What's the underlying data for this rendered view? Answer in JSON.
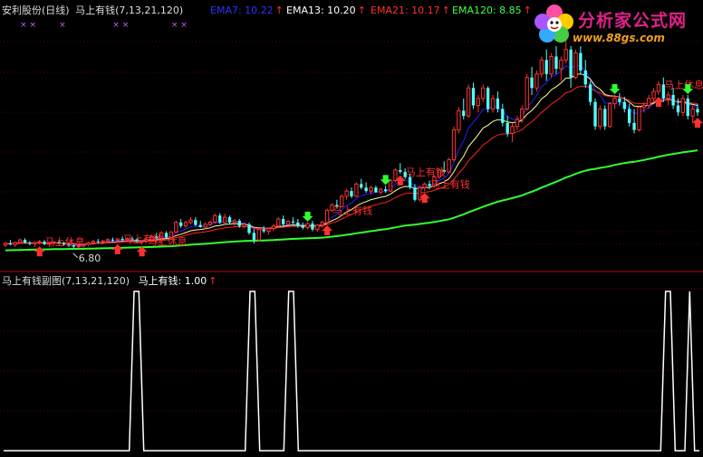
{
  "header": {
    "title": "安利股份(日线)",
    "indicator": "马上有钱(7,13,21,120)",
    "ema7": "EMA7: 10.22",
    "ema13": "EMA13: 10.20",
    "ema21": "EMA21: 10.17",
    "ema120": "EMA120: 8.85",
    "up_arrow": "↑"
  },
  "sub_header": {
    "title": "马上有钱副图(7,13,21,120)",
    "value": "马上有钱: 1.00",
    "up_arrow": "↑"
  },
  "logo": {
    "title": "分析家公式网",
    "url": "www.88gs.com"
  },
  "colors": {
    "background": "#000000",
    "bull_candle": "#ff3232",
    "bear_candle": "#54ffff",
    "ema7": "#2020ff",
    "ema13": "#ffff99",
    "ema21": "#ff2020",
    "ema120": "#30ff30",
    "signal_line": "#ffffff",
    "panel_border": "#c00000"
  },
  "chart_data": [
    {
      "type": "candlestick",
      "ylim": [
        6.2,
        13.4
      ],
      "price_labels": [
        {
          "text": "6.80",
          "index": 15,
          "value": 6.8
        }
      ],
      "candles": [
        [
          6.9,
          7.0,
          6.85,
          6.95
        ],
        [
          6.95,
          7.05,
          6.9,
          6.92
        ],
        [
          6.92,
          7.0,
          6.85,
          6.98
        ],
        [
          6.98,
          7.1,
          6.95,
          7.05
        ],
        [
          7.05,
          7.1,
          6.95,
          6.97
        ],
        [
          6.97,
          7.02,
          6.9,
          6.94
        ],
        [
          6.94,
          7.0,
          6.85,
          6.98
        ],
        [
          6.98,
          7.05,
          6.92,
          7.0
        ],
        [
          7.0,
          7.05,
          6.9,
          6.93
        ],
        [
          6.93,
          6.98,
          6.85,
          6.96
        ],
        [
          6.96,
          7.02,
          6.92,
          6.99
        ],
        [
          6.99,
          7.05,
          6.93,
          6.95
        ],
        [
          6.95,
          7.0,
          6.88,
          6.92
        ],
        [
          6.92,
          6.98,
          6.85,
          6.9
        ],
        [
          6.9,
          6.95,
          6.82,
          6.86
        ],
        [
          6.86,
          6.92,
          6.8,
          6.88
        ],
        [
          6.88,
          6.95,
          6.84,
          6.92
        ],
        [
          6.92,
          7.0,
          6.88,
          6.97
        ],
        [
          6.97,
          7.05,
          6.92,
          7.01
        ],
        [
          7.01,
          7.08,
          6.95,
          6.99
        ],
        [
          6.99,
          7.05,
          6.93,
          7.02
        ],
        [
          7.02,
          7.1,
          6.98,
          7.06
        ],
        [
          7.06,
          7.12,
          7.0,
          7.04
        ],
        [
          7.04,
          7.1,
          6.98,
          7.08
        ],
        [
          7.08,
          7.15,
          7.02,
          7.05
        ],
        [
          7.05,
          7.12,
          7.0,
          7.09
        ],
        [
          7.09,
          7.15,
          7.03,
          7.07
        ],
        [
          7.07,
          7.1,
          6.98,
          7.0
        ],
        [
          7.0,
          7.05,
          6.92,
          7.02
        ],
        [
          7.02,
          7.1,
          6.98,
          7.06
        ],
        [
          7.06,
          7.2,
          7.02,
          7.15
        ],
        [
          7.15,
          7.25,
          7.05,
          7.1
        ],
        [
          7.1,
          7.3,
          7.08,
          7.25
        ],
        [
          7.25,
          7.3,
          7.1,
          7.12
        ],
        [
          7.12,
          7.3,
          7.1,
          7.28
        ],
        [
          7.28,
          7.6,
          7.25,
          7.55
        ],
        [
          7.55,
          7.65,
          7.4,
          7.45
        ],
        [
          7.45,
          7.6,
          7.4,
          7.55
        ],
        [
          7.55,
          7.7,
          7.5,
          7.62
        ],
        [
          7.62,
          7.7,
          7.45,
          7.48
        ],
        [
          7.48,
          7.6,
          7.4,
          7.42
        ],
        [
          7.42,
          7.55,
          7.35,
          7.5
        ],
        [
          7.5,
          7.6,
          7.45,
          7.56
        ],
        [
          7.56,
          7.8,
          7.52,
          7.75
        ],
        [
          7.75,
          7.82,
          7.5,
          7.55
        ],
        [
          7.55,
          7.8,
          7.5,
          7.7
        ],
        [
          7.7,
          7.75,
          7.5,
          7.55
        ],
        [
          7.55,
          7.65,
          7.45,
          7.6
        ],
        [
          7.6,
          7.65,
          7.4,
          7.45
        ],
        [
          7.45,
          7.55,
          7.38,
          7.5
        ],
        [
          7.5,
          7.55,
          7.2,
          7.25
        ],
        [
          7.25,
          7.35,
          6.95,
          7.05
        ],
        [
          7.05,
          7.4,
          7.0,
          7.35
        ],
        [
          7.35,
          7.45,
          7.25,
          7.3
        ],
        [
          7.3,
          7.4,
          7.2,
          7.38
        ],
        [
          7.38,
          7.5,
          7.3,
          7.45
        ],
        [
          7.45,
          7.7,
          7.4,
          7.65
        ],
        [
          7.65,
          7.75,
          7.45,
          7.5
        ],
        [
          7.5,
          7.62,
          7.45,
          7.58
        ],
        [
          7.58,
          7.7,
          7.5,
          7.55
        ],
        [
          7.55,
          7.65,
          7.4,
          7.45
        ],
        [
          7.45,
          7.55,
          7.35,
          7.4
        ],
        [
          7.4,
          7.55,
          7.35,
          7.52
        ],
        [
          7.52,
          7.6,
          7.3,
          7.35
        ],
        [
          7.35,
          7.5,
          7.28,
          7.48
        ],
        [
          7.48,
          7.6,
          7.4,
          7.55
        ],
        [
          7.55,
          7.95,
          7.52,
          7.9
        ],
        [
          7.9,
          8.1,
          7.85,
          8.05
        ],
        [
          8.05,
          8.2,
          7.95,
          8.0
        ],
        [
          8.0,
          8.35,
          7.98,
          8.3
        ],
        [
          8.3,
          8.5,
          8.2,
          8.45
        ],
        [
          8.45,
          8.55,
          8.25,
          8.3
        ],
        [
          8.3,
          8.7,
          8.28,
          8.65
        ],
        [
          8.65,
          8.8,
          8.5,
          8.55
        ],
        [
          8.55,
          8.7,
          8.4,
          8.45
        ],
        [
          8.45,
          8.6,
          8.35,
          8.55
        ],
        [
          8.55,
          8.6,
          8.4,
          8.42
        ],
        [
          8.42,
          8.55,
          8.35,
          8.5
        ],
        [
          8.5,
          8.6,
          8.4,
          8.45
        ],
        [
          8.45,
          8.8,
          8.42,
          8.75
        ],
        [
          8.75,
          9.1,
          8.7,
          9.05
        ],
        [
          9.05,
          9.25,
          8.95,
          9.0
        ],
        [
          9.0,
          9.1,
          8.8,
          8.85
        ],
        [
          8.85,
          8.95,
          8.5,
          8.55
        ],
        [
          8.55,
          8.65,
          8.15,
          8.2
        ],
        [
          8.2,
          8.6,
          8.15,
          8.55
        ],
        [
          8.55,
          8.7,
          8.45,
          8.65
        ],
        [
          8.65,
          8.75,
          8.5,
          8.6
        ],
        [
          8.6,
          8.9,
          8.55,
          8.85
        ],
        [
          8.85,
          9.1,
          8.8,
          9.05
        ],
        [
          9.05,
          9.3,
          8.95,
          9.0
        ],
        [
          9.0,
          9.4,
          8.95,
          9.35
        ],
        [
          9.35,
          10.3,
          9.3,
          10.2
        ],
        [
          10.2,
          10.85,
          10.1,
          10.75
        ],
        [
          10.75,
          11.1,
          10.5,
          10.6
        ],
        [
          10.6,
          11.5,
          10.55,
          11.4
        ],
        [
          11.4,
          11.55,
          10.8,
          10.9
        ],
        [
          10.9,
          11.2,
          10.7,
          11.1
        ],
        [
          11.1,
          11.5,
          11.0,
          11.4
        ],
        [
          11.4,
          11.45,
          10.7,
          10.8
        ],
        [
          10.8,
          11.2,
          10.7,
          11.1
        ],
        [
          11.1,
          11.3,
          10.7,
          10.8
        ],
        [
          10.8,
          10.95,
          10.3,
          10.4
        ],
        [
          10.4,
          10.6,
          10.0,
          10.1
        ],
        [
          10.1,
          10.4,
          9.85,
          10.3
        ],
        [
          10.3,
          10.6,
          10.2,
          10.5
        ],
        [
          10.5,
          10.9,
          10.4,
          10.8
        ],
        [
          10.8,
          11.8,
          10.75,
          11.7
        ],
        [
          11.7,
          12.0,
          11.2,
          11.4
        ],
        [
          11.4,
          11.9,
          11.3,
          11.8
        ],
        [
          11.8,
          12.3,
          11.7,
          12.2
        ],
        [
          12.2,
          12.5,
          11.6,
          11.8
        ],
        [
          11.8,
          12.4,
          11.7,
          12.3
        ],
        [
          12.3,
          12.6,
          11.8,
          11.95
        ],
        [
          11.95,
          12.3,
          11.6,
          12.2
        ],
        [
          12.2,
          13.0,
          12.1,
          12.5
        ],
        [
          12.5,
          12.6,
          11.4,
          11.7
        ],
        [
          11.7,
          12.5,
          11.65,
          12.4
        ],
        [
          12.4,
          12.6,
          11.8,
          11.9
        ],
        [
          11.9,
          12.2,
          11.4,
          11.5
        ],
        [
          11.5,
          11.6,
          10.9,
          11.0
        ],
        [
          11.0,
          11.1,
          10.2,
          10.3
        ],
        [
          10.3,
          10.9,
          10.2,
          10.8
        ],
        [
          10.8,
          10.9,
          10.2,
          10.3
        ],
        [
          10.3,
          11.0,
          10.25,
          10.95
        ],
        [
          10.95,
          11.2,
          10.8,
          11.1
        ],
        [
          11.1,
          11.25,
          10.9,
          11.0
        ],
        [
          11.0,
          11.15,
          10.7,
          10.8
        ],
        [
          10.8,
          10.95,
          10.3,
          10.4
        ],
        [
          10.4,
          10.8,
          10.1,
          10.2
        ],
        [
          10.2,
          10.9,
          10.15,
          10.85
        ],
        [
          10.85,
          11.0,
          10.7,
          10.9
        ],
        [
          10.9,
          11.2,
          10.8,
          11.1
        ],
        [
          11.1,
          11.4,
          11.0,
          11.3
        ],
        [
          11.3,
          11.6,
          11.2,
          11.5
        ],
        [
          11.5,
          11.7,
          11.0,
          11.1
        ],
        [
          11.1,
          11.3,
          10.9,
          11.2
        ],
        [
          11.2,
          11.4,
          10.8,
          10.9
        ],
        [
          10.9,
          11.1,
          10.6,
          10.7
        ],
        [
          10.7,
          11.2,
          10.6,
          11.1
        ],
        [
          11.1,
          11.2,
          10.5,
          10.6
        ],
        [
          10.6,
          10.9,
          10.4,
          10.8
        ],
        [
          10.8,
          10.95,
          10.6,
          10.7
        ]
      ],
      "signals": [
        {
          "index": 7,
          "kind": "buy",
          "label": "马上休息"
        },
        {
          "index": 23,
          "kind": "buy",
          "label": "马上有钱"
        },
        {
          "index": 28,
          "kind": "buy",
          "label": "马上休息"
        },
        {
          "index": 62,
          "kind": "sell",
          "label": ""
        },
        {
          "index": 66,
          "kind": "buy",
          "label": "马上有钱"
        },
        {
          "index": 81,
          "kind": "buy",
          "label": "马上有钱"
        },
        {
          "index": 78,
          "kind": "sell",
          "label": ""
        },
        {
          "index": 86,
          "kind": "buy",
          "label": "马上有钱"
        },
        {
          "index": 125,
          "kind": "sell",
          "label": ""
        },
        {
          "index": 134,
          "kind": "buy",
          "label": "马上休息"
        },
        {
          "index": 140,
          "kind": "sell",
          "label": ""
        },
        {
          "index": 142,
          "kind": "buy",
          "label": "马上有钱"
        }
      ],
      "markers": [
        {
          "index": 3,
          "text": "× ×"
        },
        {
          "index": 11,
          "text": "×"
        },
        {
          "index": 22,
          "text": "× ×"
        },
        {
          "index": 34,
          "text": "× ×"
        }
      ],
      "ema_periods": [
        7,
        13,
        21,
        120
      ],
      "ema_names": [
        "EMA7",
        "EMA13",
        "EMA21",
        "EMA120"
      ],
      "ema120_start": 6.75
    },
    {
      "type": "line",
      "series": [
        {
          "name": "马上有钱",
          "values_one_at": [
            27,
            28,
            51,
            52,
            59,
            60,
            137,
            138,
            142
          ]
        }
      ],
      "length": 145,
      "ylim": [
        0,
        1
      ]
    }
  ]
}
